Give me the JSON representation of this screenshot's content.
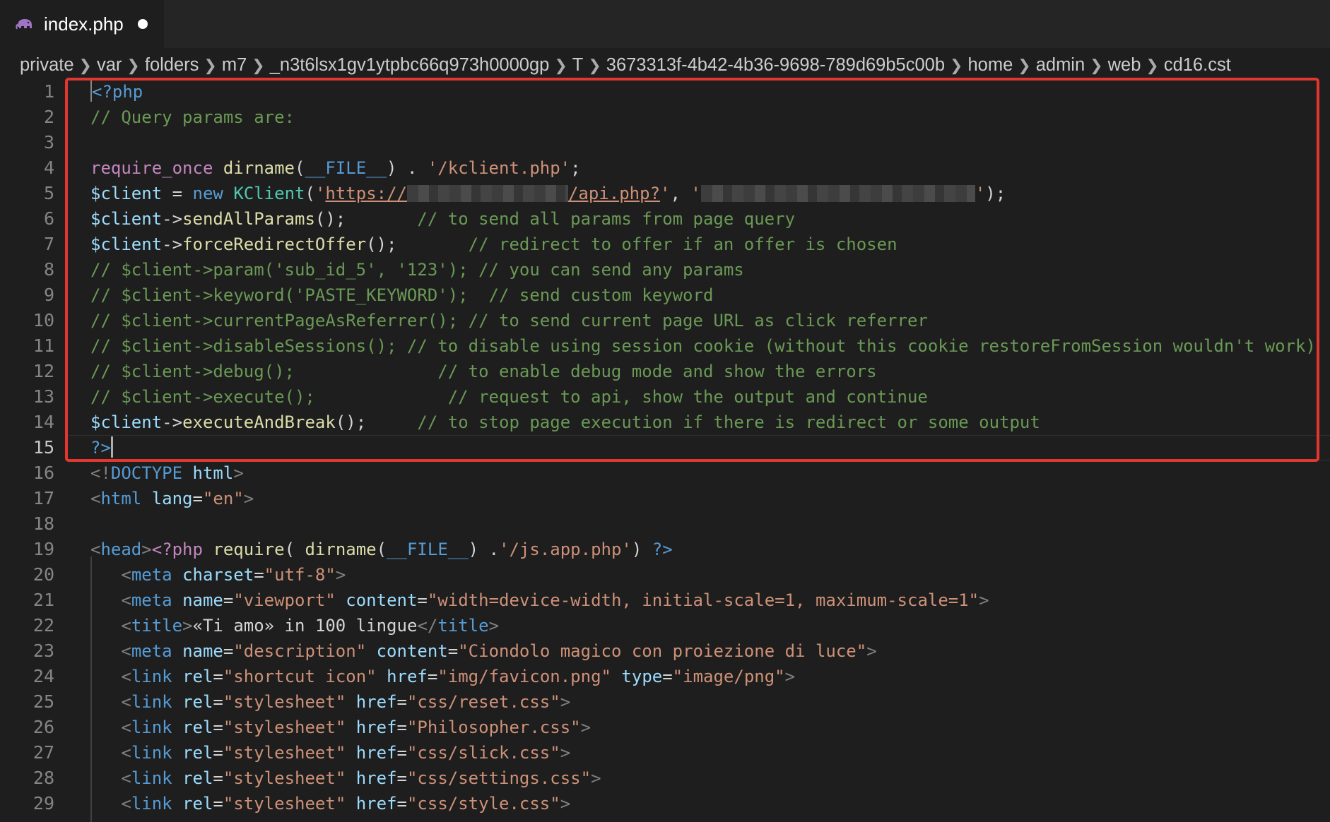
{
  "tab": {
    "filename": "index.php",
    "icon": "php-elephant-icon",
    "unsaved": true
  },
  "breadcrumb": [
    "private",
    "var",
    "folders",
    "m7",
    "_n3t6lsx1gv1ytpbc66q973h0000gp",
    "T",
    "3673313f-4b42-4b36-9698-789d69b5c00b",
    "home",
    "admin",
    "web",
    "cd16.cst"
  ],
  "editor": {
    "active_line": 15,
    "lines": [
      {
        "n": "1",
        "segs": [
          [
            "<?php",
            "t"
          ]
        ],
        "cursor_start": true
      },
      {
        "n": "2",
        "segs": [
          [
            "// Query params are:",
            "c"
          ]
        ]
      },
      {
        "n": "3",
        "segs": []
      },
      {
        "n": "4",
        "segs": [
          [
            "require_once",
            "k"
          ],
          [
            " ",
            "p"
          ],
          [
            "dirname",
            "f"
          ],
          [
            "(",
            "p"
          ],
          [
            "__FILE__",
            "t"
          ],
          [
            ") . ",
            "p"
          ],
          [
            "'/kclient.php'",
            "s"
          ],
          [
            ";",
            "p"
          ]
        ]
      },
      {
        "n": "5",
        "segs": [
          [
            "$client",
            "v"
          ],
          [
            " = ",
            "p"
          ],
          [
            "new",
            "t"
          ],
          [
            " ",
            "p"
          ],
          [
            "KClient",
            "cl"
          ],
          [
            "(",
            "p"
          ],
          [
            "'",
            "s"
          ],
          [
            "https://",
            "u"
          ],
          [
            "",
            "blur:228"
          ],
          [
            "/api.php?",
            "u"
          ],
          [
            "'",
            "s"
          ],
          [
            ", ",
            "p"
          ],
          [
            "'",
            "s"
          ],
          [
            "",
            "blur:388"
          ],
          [
            "'",
            "s"
          ],
          [
            ");",
            "p"
          ]
        ]
      },
      {
        "n": "6",
        "segs": [
          [
            "$client",
            "v"
          ],
          [
            "->",
            "p"
          ],
          [
            "sendAllParams",
            "f"
          ],
          [
            "();       ",
            "p"
          ],
          [
            "// to send all params from page query",
            "c"
          ]
        ]
      },
      {
        "n": "7",
        "segs": [
          [
            "$client",
            "v"
          ],
          [
            "->",
            "p"
          ],
          [
            "forceRedirectOffer",
            "f"
          ],
          [
            "();       ",
            "p"
          ],
          [
            "// redirect to offer if an offer is chosen",
            "c"
          ]
        ]
      },
      {
        "n": "8",
        "segs": [
          [
            "// $client->param('sub_id_5', '123'); // you can send any params",
            "c"
          ]
        ]
      },
      {
        "n": "9",
        "segs": [
          [
            "// $client->keyword('PASTE_KEYWORD');  // send custom keyword",
            "c"
          ]
        ]
      },
      {
        "n": "10",
        "segs": [
          [
            "// $client->currentPageAsReferrer(); // to send current page URL as click referrer",
            "c"
          ]
        ]
      },
      {
        "n": "11",
        "segs": [
          [
            "// $client->disableSessions(); // to disable using session cookie (without this cookie restoreFromSession wouldn't work)",
            "c"
          ]
        ]
      },
      {
        "n": "12",
        "segs": [
          [
            "// $client->debug();              // to enable debug mode and show the errors",
            "c"
          ]
        ]
      },
      {
        "n": "13",
        "segs": [
          [
            "// $client->execute();             // request to api, show the output and continue",
            "c"
          ]
        ]
      },
      {
        "n": "14",
        "segs": [
          [
            "$client",
            "v"
          ],
          [
            "->",
            "p"
          ],
          [
            "executeAndBreak",
            "f"
          ],
          [
            "();     ",
            "p"
          ],
          [
            "// to stop page execution if there is redirect or some output",
            "c"
          ]
        ]
      },
      {
        "n": "15",
        "segs": [
          [
            "?>",
            "t"
          ]
        ],
        "cursor_end": true
      },
      {
        "n": "16",
        "segs": [
          [
            "<!",
            "ts"
          ],
          [
            "DOCTYPE",
            "t"
          ],
          [
            " ",
            "p"
          ],
          [
            "html",
            "a"
          ],
          [
            ">",
            "ts"
          ]
        ]
      },
      {
        "n": "17",
        "segs": [
          [
            "<",
            "ts"
          ],
          [
            "html",
            "t"
          ],
          [
            " ",
            "p"
          ],
          [
            "lang",
            "a"
          ],
          [
            "=",
            "p"
          ],
          [
            "\"en\"",
            "s"
          ],
          [
            ">",
            "ts"
          ]
        ]
      },
      {
        "n": "18",
        "segs": []
      },
      {
        "n": "19",
        "segs": [
          [
            "<",
            "ts"
          ],
          [
            "head",
            "t"
          ],
          [
            ">",
            "ts"
          ],
          [
            "<?php",
            "k"
          ],
          [
            " ",
            "p"
          ],
          [
            "require",
            "f"
          ],
          [
            "( ",
            "p"
          ],
          [
            "dirname",
            "f"
          ],
          [
            "(",
            "p"
          ],
          [
            "__FILE__",
            "t"
          ],
          [
            ") .",
            "p"
          ],
          [
            "'/js.app.php'",
            "s"
          ],
          [
            ") ",
            "p"
          ],
          [
            "?>",
            "t"
          ]
        ]
      },
      {
        "n": "20",
        "segs": [
          [
            "   ",
            "p"
          ],
          [
            "<",
            "ts"
          ],
          [
            "meta",
            "t"
          ],
          [
            " ",
            "p"
          ],
          [
            "charset",
            "a"
          ],
          [
            "=",
            "p"
          ],
          [
            "\"utf-8\"",
            "s"
          ],
          [
            ">",
            "ts"
          ]
        ]
      },
      {
        "n": "21",
        "segs": [
          [
            "   ",
            "p"
          ],
          [
            "<",
            "ts"
          ],
          [
            "meta",
            "t"
          ],
          [
            " ",
            "p"
          ],
          [
            "name",
            "a"
          ],
          [
            "=",
            "p"
          ],
          [
            "\"viewport\"",
            "s"
          ],
          [
            " ",
            "p"
          ],
          [
            "content",
            "a"
          ],
          [
            "=",
            "p"
          ],
          [
            "\"width=device-width, initial-scale=1, maximum-scale=1\"",
            "s"
          ],
          [
            ">",
            "ts"
          ]
        ]
      },
      {
        "n": "22",
        "segs": [
          [
            "   ",
            "p"
          ],
          [
            "<",
            "ts"
          ],
          [
            "title",
            "t"
          ],
          [
            ">",
            "ts"
          ],
          [
            "«Ti amo» in 100 lingue",
            "p"
          ],
          [
            "</",
            "ts"
          ],
          [
            "title",
            "t"
          ],
          [
            ">",
            "ts"
          ]
        ]
      },
      {
        "n": "23",
        "segs": [
          [
            "   ",
            "p"
          ],
          [
            "<",
            "ts"
          ],
          [
            "meta",
            "t"
          ],
          [
            " ",
            "p"
          ],
          [
            "name",
            "a"
          ],
          [
            "=",
            "p"
          ],
          [
            "\"description\"",
            "s"
          ],
          [
            " ",
            "p"
          ],
          [
            "content",
            "a"
          ],
          [
            "=",
            "p"
          ],
          [
            "\"Ciondolo magico con proiezione di luce\"",
            "s"
          ],
          [
            ">",
            "ts"
          ]
        ]
      },
      {
        "n": "24",
        "segs": [
          [
            "   ",
            "p"
          ],
          [
            "<",
            "ts"
          ],
          [
            "link",
            "t"
          ],
          [
            " ",
            "p"
          ],
          [
            "rel",
            "a"
          ],
          [
            "=",
            "p"
          ],
          [
            "\"shortcut icon\"",
            "s"
          ],
          [
            " ",
            "p"
          ],
          [
            "href",
            "a"
          ],
          [
            "=",
            "p"
          ],
          [
            "\"img/favicon.png\"",
            "s"
          ],
          [
            " ",
            "p"
          ],
          [
            "type",
            "a"
          ],
          [
            "=",
            "p"
          ],
          [
            "\"image/png\"",
            "s"
          ],
          [
            ">",
            "ts"
          ]
        ]
      },
      {
        "n": "25",
        "segs": [
          [
            "   ",
            "p"
          ],
          [
            "<",
            "ts"
          ],
          [
            "link",
            "t"
          ],
          [
            " ",
            "p"
          ],
          [
            "rel",
            "a"
          ],
          [
            "=",
            "p"
          ],
          [
            "\"stylesheet\"",
            "s"
          ],
          [
            " ",
            "p"
          ],
          [
            "href",
            "a"
          ],
          [
            "=",
            "p"
          ],
          [
            "\"css/reset.css\"",
            "s"
          ],
          [
            ">",
            "ts"
          ]
        ]
      },
      {
        "n": "26",
        "segs": [
          [
            "   ",
            "p"
          ],
          [
            "<",
            "ts"
          ],
          [
            "link",
            "t"
          ],
          [
            " ",
            "p"
          ],
          [
            "rel",
            "a"
          ],
          [
            "=",
            "p"
          ],
          [
            "\"stylesheet\"",
            "s"
          ],
          [
            " ",
            "p"
          ],
          [
            "href",
            "a"
          ],
          [
            "=",
            "p"
          ],
          [
            "\"Philosopher.css\"",
            "s"
          ],
          [
            ">",
            "ts"
          ]
        ]
      },
      {
        "n": "27",
        "segs": [
          [
            "   ",
            "p"
          ],
          [
            "<",
            "ts"
          ],
          [
            "link",
            "t"
          ],
          [
            " ",
            "p"
          ],
          [
            "rel",
            "a"
          ],
          [
            "=",
            "p"
          ],
          [
            "\"stylesheet\"",
            "s"
          ],
          [
            " ",
            "p"
          ],
          [
            "href",
            "a"
          ],
          [
            "=",
            "p"
          ],
          [
            "\"css/slick.css\"",
            "s"
          ],
          [
            ">",
            "ts"
          ]
        ]
      },
      {
        "n": "28",
        "segs": [
          [
            "   ",
            "p"
          ],
          [
            "<",
            "ts"
          ],
          [
            "link",
            "t"
          ],
          [
            " ",
            "p"
          ],
          [
            "rel",
            "a"
          ],
          [
            "=",
            "p"
          ],
          [
            "\"stylesheet\"",
            "s"
          ],
          [
            " ",
            "p"
          ],
          [
            "href",
            "a"
          ],
          [
            "=",
            "p"
          ],
          [
            "\"css/settings.css\"",
            "s"
          ],
          [
            ">",
            "ts"
          ]
        ]
      },
      {
        "n": "29",
        "segs": [
          [
            "   ",
            "p"
          ],
          [
            "<",
            "ts"
          ],
          [
            "link",
            "t"
          ],
          [
            " ",
            "p"
          ],
          [
            "rel",
            "a"
          ],
          [
            "=",
            "p"
          ],
          [
            "\"stylesheet\"",
            "s"
          ],
          [
            " ",
            "p"
          ],
          [
            "href",
            "a"
          ],
          [
            "=",
            "p"
          ],
          [
            "\"css/style.css\"",
            "s"
          ],
          [
            ">",
            "ts"
          ]
        ]
      }
    ]
  },
  "colors": {
    "highlight_box": "#e2372e",
    "background": "#1e1e1e",
    "tabbar": "#252526"
  }
}
